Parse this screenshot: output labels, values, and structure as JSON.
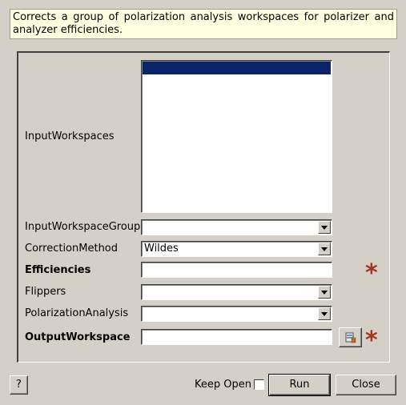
{
  "description": "Corrects a group of polarization analysis workspaces for polarizer and analyzer efficiencies.",
  "properties": {
    "input_workspaces": {
      "label": "InputWorkspaces"
    },
    "input_workspace_group": {
      "label": "InputWorkspaceGroup",
      "value": ""
    },
    "correction_method": {
      "label": "CorrectionMethod",
      "value": "Wildes"
    },
    "efficiencies": {
      "label": "Efficiencies",
      "value": "",
      "required": true
    },
    "flippers": {
      "label": "Flippers",
      "value": ""
    },
    "polarization_analysis": {
      "label": "PolarizationAnalysis",
      "value": ""
    },
    "output_workspace": {
      "label": "OutputWorkspace",
      "value": "",
      "required": true
    }
  },
  "required_marker": "*",
  "footer": {
    "help_label": "?",
    "keep_open_label": "Keep Open",
    "keep_open_checked": false,
    "run_label": "Run",
    "close_label": "Close"
  },
  "colors": {
    "required_star": "#a33524",
    "selection": "#0a246a",
    "description_bg": "#ffffe1"
  }
}
